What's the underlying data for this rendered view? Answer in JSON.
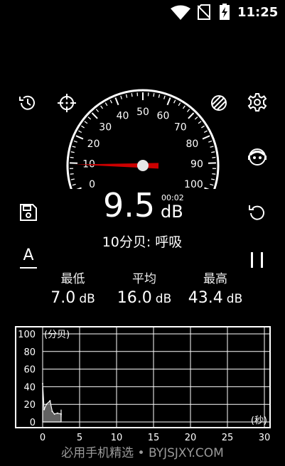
{
  "status_bar": {
    "time": "11:25"
  },
  "gauge": {
    "ticks": [
      "0",
      "10",
      "20",
      "30",
      "40",
      "50",
      "60",
      "70",
      "80",
      "90",
      "100"
    ],
    "needle_value": 9.5
  },
  "reading": {
    "value": "9.5",
    "unit": "dB",
    "elapsed": "00:02",
    "description": "10分贝: 呼吸"
  },
  "stats": {
    "min": {
      "label": "最低",
      "value": "7.0",
      "unit": "dB"
    },
    "avg": {
      "label": "平均",
      "value": "16.0",
      "unit": "dB"
    },
    "max": {
      "label": "最高",
      "value": "43.4",
      "unit": "dB"
    }
  },
  "weighting_label": "A",
  "chart": {
    "ylabel": "(分贝)",
    "xlabel": "(秒)",
    "y_ticks": [
      "100",
      "80",
      "60",
      "40",
      "20",
      "0"
    ],
    "x_ticks": [
      "0",
      "5",
      "10",
      "15",
      "20",
      "25",
      "30"
    ]
  },
  "chart_data": {
    "type": "area",
    "xlabel": "(秒)",
    "ylabel": "(分贝)",
    "xlim": [
      0,
      30
    ],
    "ylim": [
      0,
      100
    ],
    "grid": true,
    "x": [
      0,
      0.2,
      0.5,
      1.0,
      1.3,
      1.6,
      2.0,
      2.5
    ],
    "values": [
      43.4,
      14,
      20,
      24,
      12,
      9,
      10,
      9
    ]
  },
  "watermark": "必用手机精选 • BYJSJXY.COM",
  "colors": {
    "needle": "#cc0000",
    "background": "#000000"
  }
}
